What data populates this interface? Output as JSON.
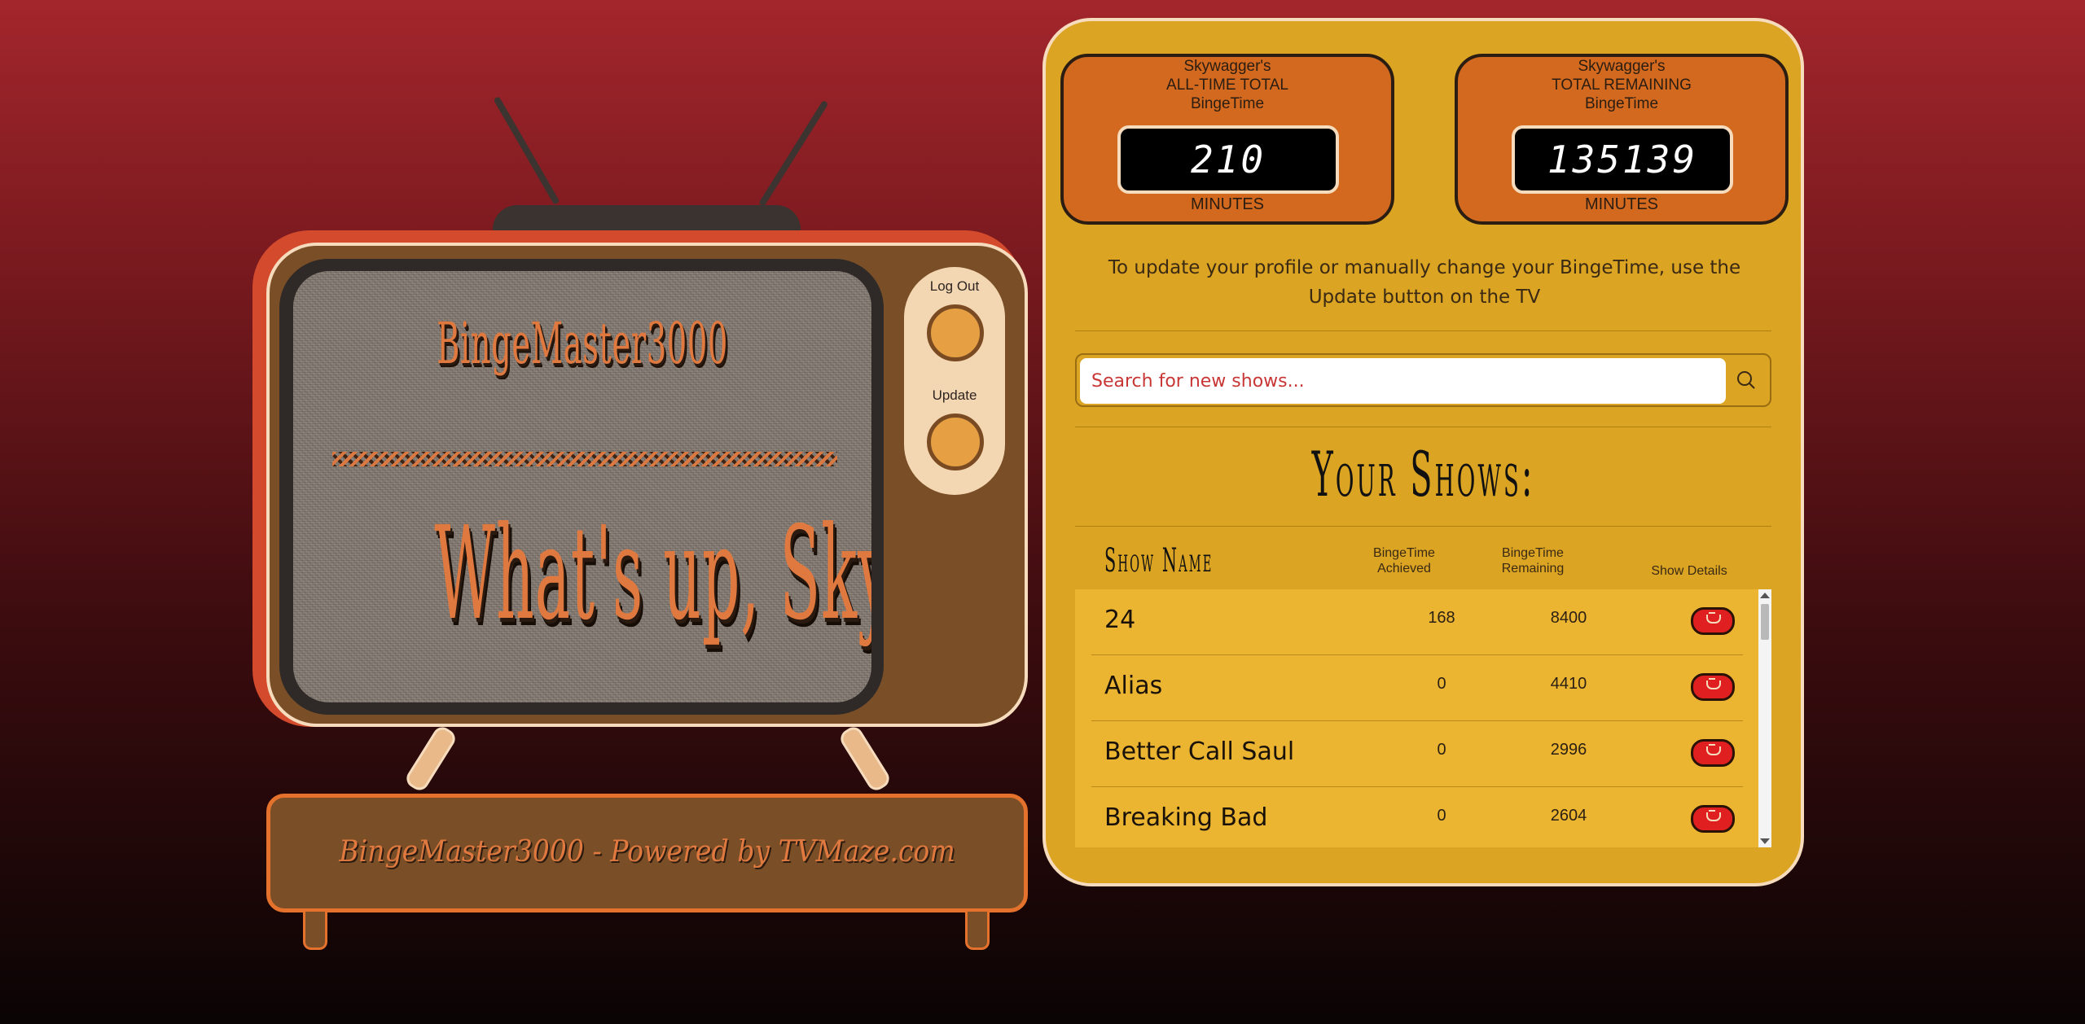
{
  "tv": {
    "title": "BingeMaster3000",
    "greeting": "What's up, Skywagger!",
    "logout_label": "Log Out",
    "update_label": "Update",
    "stand_text": "BingeMaster3000 - Powered by TVMaze.com"
  },
  "stats": {
    "total": {
      "owner": "Skywagger's",
      "heading": "ALL-TIME TOTAL",
      "sub": "BingeTime",
      "value": "210",
      "unit": "MINUTES"
    },
    "remaining": {
      "owner": "Skywagger's",
      "heading": "TOTAL REMAINING",
      "sub": "BingeTime",
      "value": "135139",
      "unit": "MINUTES"
    }
  },
  "info_text": "To update your profile or manually change your BingeTime, use the Update button on the TV",
  "search": {
    "placeholder": "Search for new shows..."
  },
  "shows_heading": "Your Shows:",
  "columns": {
    "name": "Show Name",
    "achieved_1": "BingeTime",
    "achieved_2": "Achieved",
    "remaining_1": "BingeTime",
    "remaining_2": "Remaining",
    "details": "Show Details"
  },
  "shows": [
    {
      "name": "24",
      "achieved": "168",
      "remaining": "8400"
    },
    {
      "name": "Alias",
      "achieved": "0",
      "remaining": "4410"
    },
    {
      "name": "Better Call Saul",
      "achieved": "0",
      "remaining": "2996"
    },
    {
      "name": "Breaking Bad",
      "achieved": "0",
      "remaining": "2604"
    }
  ],
  "colors": {
    "accent": "#dca423",
    "tv_orange": "#e0793f",
    "button_red": "#e02020"
  }
}
